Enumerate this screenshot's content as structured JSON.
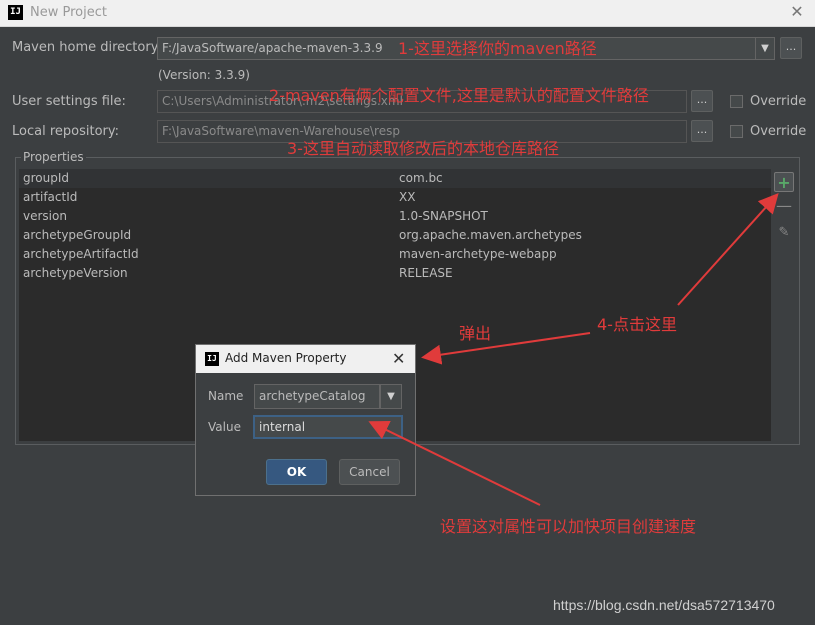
{
  "window": {
    "app_icon_text": "IJ",
    "title": "New Project",
    "close_glyph": "✕"
  },
  "form": {
    "maven_home_label": "Maven home directory:",
    "maven_home_value": "F:/JavaSoftware/apache-maven-3.3.9",
    "maven_version": "(Version: 3.3.9)",
    "user_settings_label": "User settings file:",
    "user_settings_value": "C:\\Users\\Administrator\\.m2\\settings.xml",
    "local_repo_label": "Local repository:",
    "local_repo_value": "F:\\JavaSoftware\\maven-Warehouse\\resp",
    "override_label": "Override",
    "browse_label": "...",
    "combo_arrow": "▼"
  },
  "properties": {
    "group_label": "Properties",
    "rows": [
      {
        "key": "groupId",
        "value": "com.bc"
      },
      {
        "key": "artifactId",
        "value": "XX"
      },
      {
        "key": "version",
        "value": "1.0-SNAPSHOT"
      },
      {
        "key": "archetypeGroupId",
        "value": "org.apache.maven.archetypes"
      },
      {
        "key": "archetypeArtifactId",
        "value": "maven-archetype-webapp"
      },
      {
        "key": "archetypeVersion",
        "value": "RELEASE"
      }
    ],
    "tools": {
      "add": "+",
      "remove": "—",
      "edit": "✎"
    }
  },
  "dialog": {
    "icon_text": "IJ",
    "title": "Add Maven Property",
    "close_glyph": "✕",
    "name_label": "Name",
    "name_value": "archetypeCatalog",
    "value_label": "Value",
    "value_value": "internal",
    "ok_label": "OK",
    "cancel_label": "Cancel",
    "combo_arrow": "▼"
  },
  "annotations": {
    "a1": "1-这里选择你的maven路径",
    "a2": "2-maven有俩个配置文件,这里是默认的配置文件路径",
    "a3": "3-这里自动读取修改后的本地仓库路径",
    "a4": "4-点击这里",
    "popup": "弹出",
    "speed": "设置这对属性可以加快项目创建速度",
    "color": "#e03b3b"
  },
  "watermark": "https://blog.csdn.net/dsa572713470"
}
